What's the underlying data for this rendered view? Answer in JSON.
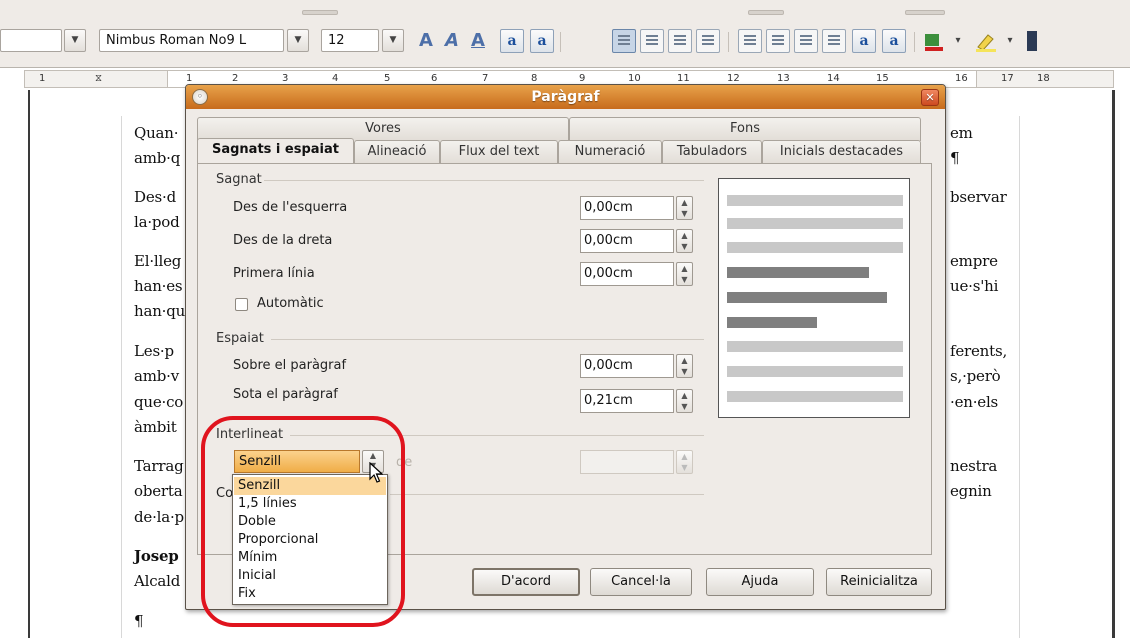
{
  "toolbar": {
    "font_name": "Nimbus Roman No9 L",
    "font_size": "12",
    "bold_icon_glyph": "A",
    "italic_icon_glyph": "A",
    "underline_icon_glyph": "A",
    "superscript_glyph": "a",
    "subscript_glyph": "a",
    "grow_glyph": "a",
    "shrink_glyph": "a"
  },
  "ruler": {
    "marks": [
      "1",
      "1",
      "2",
      "3",
      "4",
      "5",
      "6",
      "7",
      "8",
      "9",
      "10",
      "11",
      "12",
      "13",
      "14",
      "15",
      "16",
      "17",
      "18"
    ]
  },
  "document": {
    "fragments_left": [
      "Quan·",
      "amb·q",
      "Des·d",
      "la·pod",
      "El·lleg",
      "han·es",
      "han·qu",
      "Les·p",
      "amb·v",
      "que·co",
      "àmbit",
      "Tarrag",
      "oberta",
      "de·la·p",
      "Josep",
      "Alcald",
      "¶"
    ],
    "fragments_right": [
      "em",
      "¶",
      "bservar",
      "empre",
      "ue·s'hi",
      "ferents,",
      "s,·però",
      "·en·els",
      "nestra",
      "egnin"
    ]
  },
  "dialog": {
    "title": "Paràgraf",
    "tabs_top": [
      "Vores",
      "Fons"
    ],
    "tabs_bottom": [
      "Sagnats i espaiat",
      "Alineació",
      "Flux del text",
      "Numeració",
      "Tabuladors",
      "Inicials destacades"
    ],
    "sagnat": {
      "title": "Sagnat",
      "rows": [
        {
          "label": "Des de l'esquerra",
          "value": "0,00cm"
        },
        {
          "label": "Des de la dreta",
          "value": "0,00cm"
        },
        {
          "label": "Primera línia",
          "value": "0,00cm"
        }
      ],
      "auto_label": "Automàtic"
    },
    "espaiat": {
      "title": "Espaiat",
      "rows": [
        {
          "label": "Sobre el paràgraf",
          "value": "0,00cm"
        },
        {
          "label": "Sota el paràgraf",
          "value": "0,21cm"
        }
      ]
    },
    "interlineat": {
      "title": "Interlineat",
      "selected": "Senzill",
      "de_label": "de",
      "de_value": "",
      "options": [
        "Senzill",
        "1,5 línies",
        "Doble",
        "Proporcional",
        "Mínim",
        "Inicial",
        "Fix"
      ]
    },
    "partial_group_label": "Co",
    "buttons": {
      "ok": "D'acord",
      "cancel": "Cancel·la",
      "help": "Ajuda",
      "reset": "Reinicialitza"
    }
  },
  "colors": {
    "title_bar": "#d5802e",
    "highlight": "#e0141e",
    "selected_option": "#fbd79c"
  }
}
